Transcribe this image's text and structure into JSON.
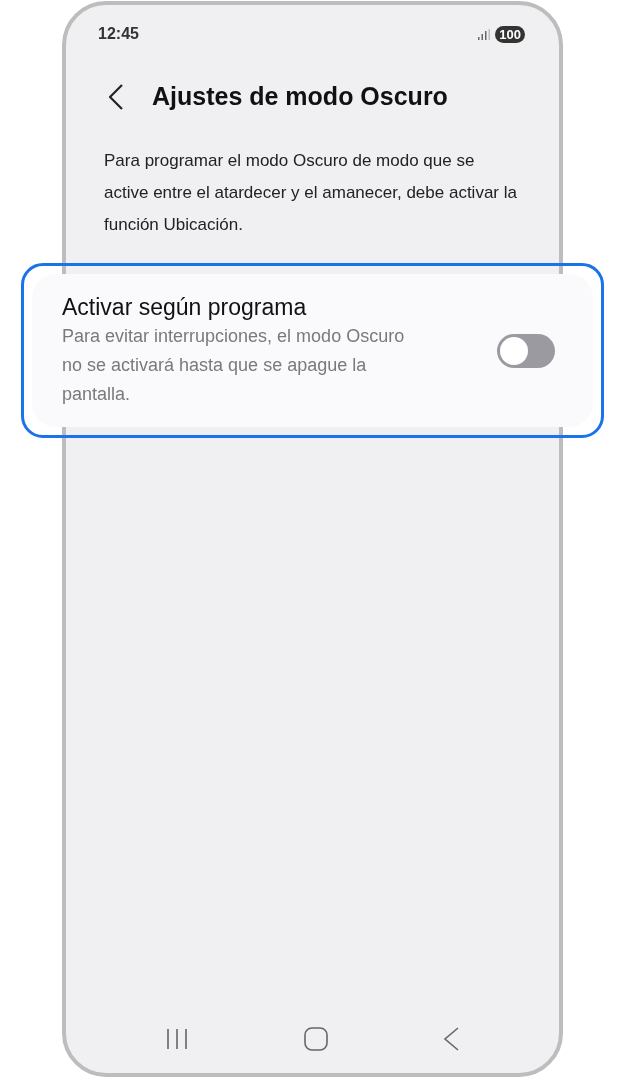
{
  "status_bar": {
    "time": "12:45",
    "battery": "100"
  },
  "header": {
    "title": "Ajustes de modo Oscuro"
  },
  "description": "Para programar el modo Oscuro de modo que se active entre el atardecer y el amanecer, debe activar la función Ubicación.",
  "setting": {
    "title": "Activar según programa",
    "description": "Para evitar interrupciones, el modo Oscuro no se activará hasta que se apague la pantalla.",
    "on": false,
    "highlighted": true
  }
}
